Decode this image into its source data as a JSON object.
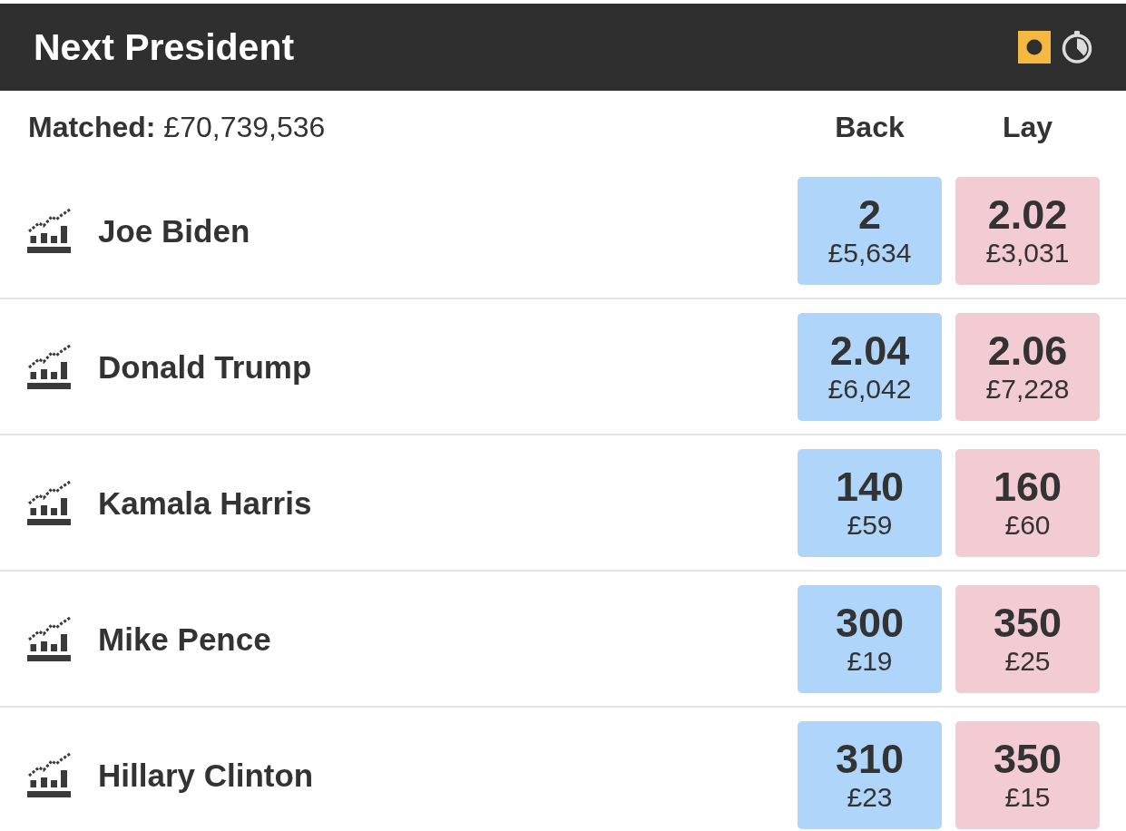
{
  "header": {
    "title": "Next President"
  },
  "summary": {
    "matched": "**Matched:** £70,739,536"
  },
  "columns": [
    "Back",
    "Lay"
  ],
  "runners": [
    {
      "name": "Joe Biden",
      "prices": [
        {
          "kind": "back",
          "price": "2",
          "size": "£5,634"
        },
        {
          "kind": "lay",
          "price": "2.02",
          "size": "£3,031"
        }
      ]
    },
    {
      "name": "Donald Trump",
      "prices": [
        {
          "kind": "back",
          "price": "2.04",
          "size": "£6,042"
        },
        {
          "kind": "lay",
          "price": "2.06",
          "size": "£7,228"
        }
      ]
    },
    {
      "name": "Kamala Harris",
      "prices": [
        {
          "kind": "back",
          "price": "140",
          "size": "£59"
        },
        {
          "kind": "lay",
          "price": "160",
          "size": "£60"
        }
      ]
    },
    {
      "name": "Mike Pence",
      "prices": [
        {
          "kind": "back",
          "price": "300",
          "size": "£19"
        },
        {
          "kind": "lay",
          "price": "350",
          "size": "£25"
        }
      ]
    },
    {
      "name": "Hillary Clinton",
      "prices": [
        {
          "kind": "back",
          "price": "310",
          "size": "£23"
        },
        {
          "kind": "lay",
          "price": "350",
          "size": "£15"
        }
      ]
    }
  ]
}
